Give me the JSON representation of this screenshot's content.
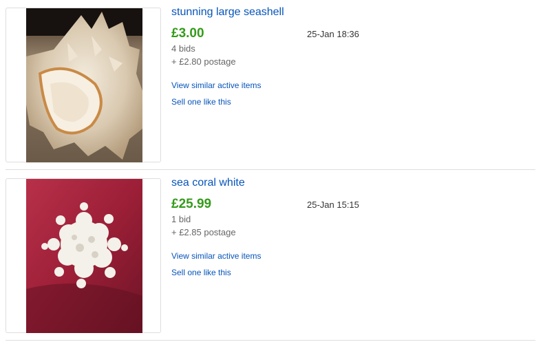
{
  "listings": [
    {
      "title": "stunning large seashell",
      "price": "£3.00",
      "end_time": "25-Jan 18:36",
      "bids": "4 bids",
      "postage": "+ £2.80 postage",
      "similar_link": "View similar active items",
      "sell_link": "Sell one like this",
      "image_icon": "seashell-photo"
    },
    {
      "title": "sea coral white",
      "price": "£25.99",
      "end_time": "25-Jan 15:15",
      "bids": "1 bid",
      "postage": "+ £2.85 postage",
      "similar_link": "View similar active items",
      "sell_link": "Sell one like this",
      "image_icon": "coral-photo"
    }
  ],
  "colors": {
    "link": "#0654ba",
    "price": "#359b1b",
    "divider": "#dddddd"
  }
}
